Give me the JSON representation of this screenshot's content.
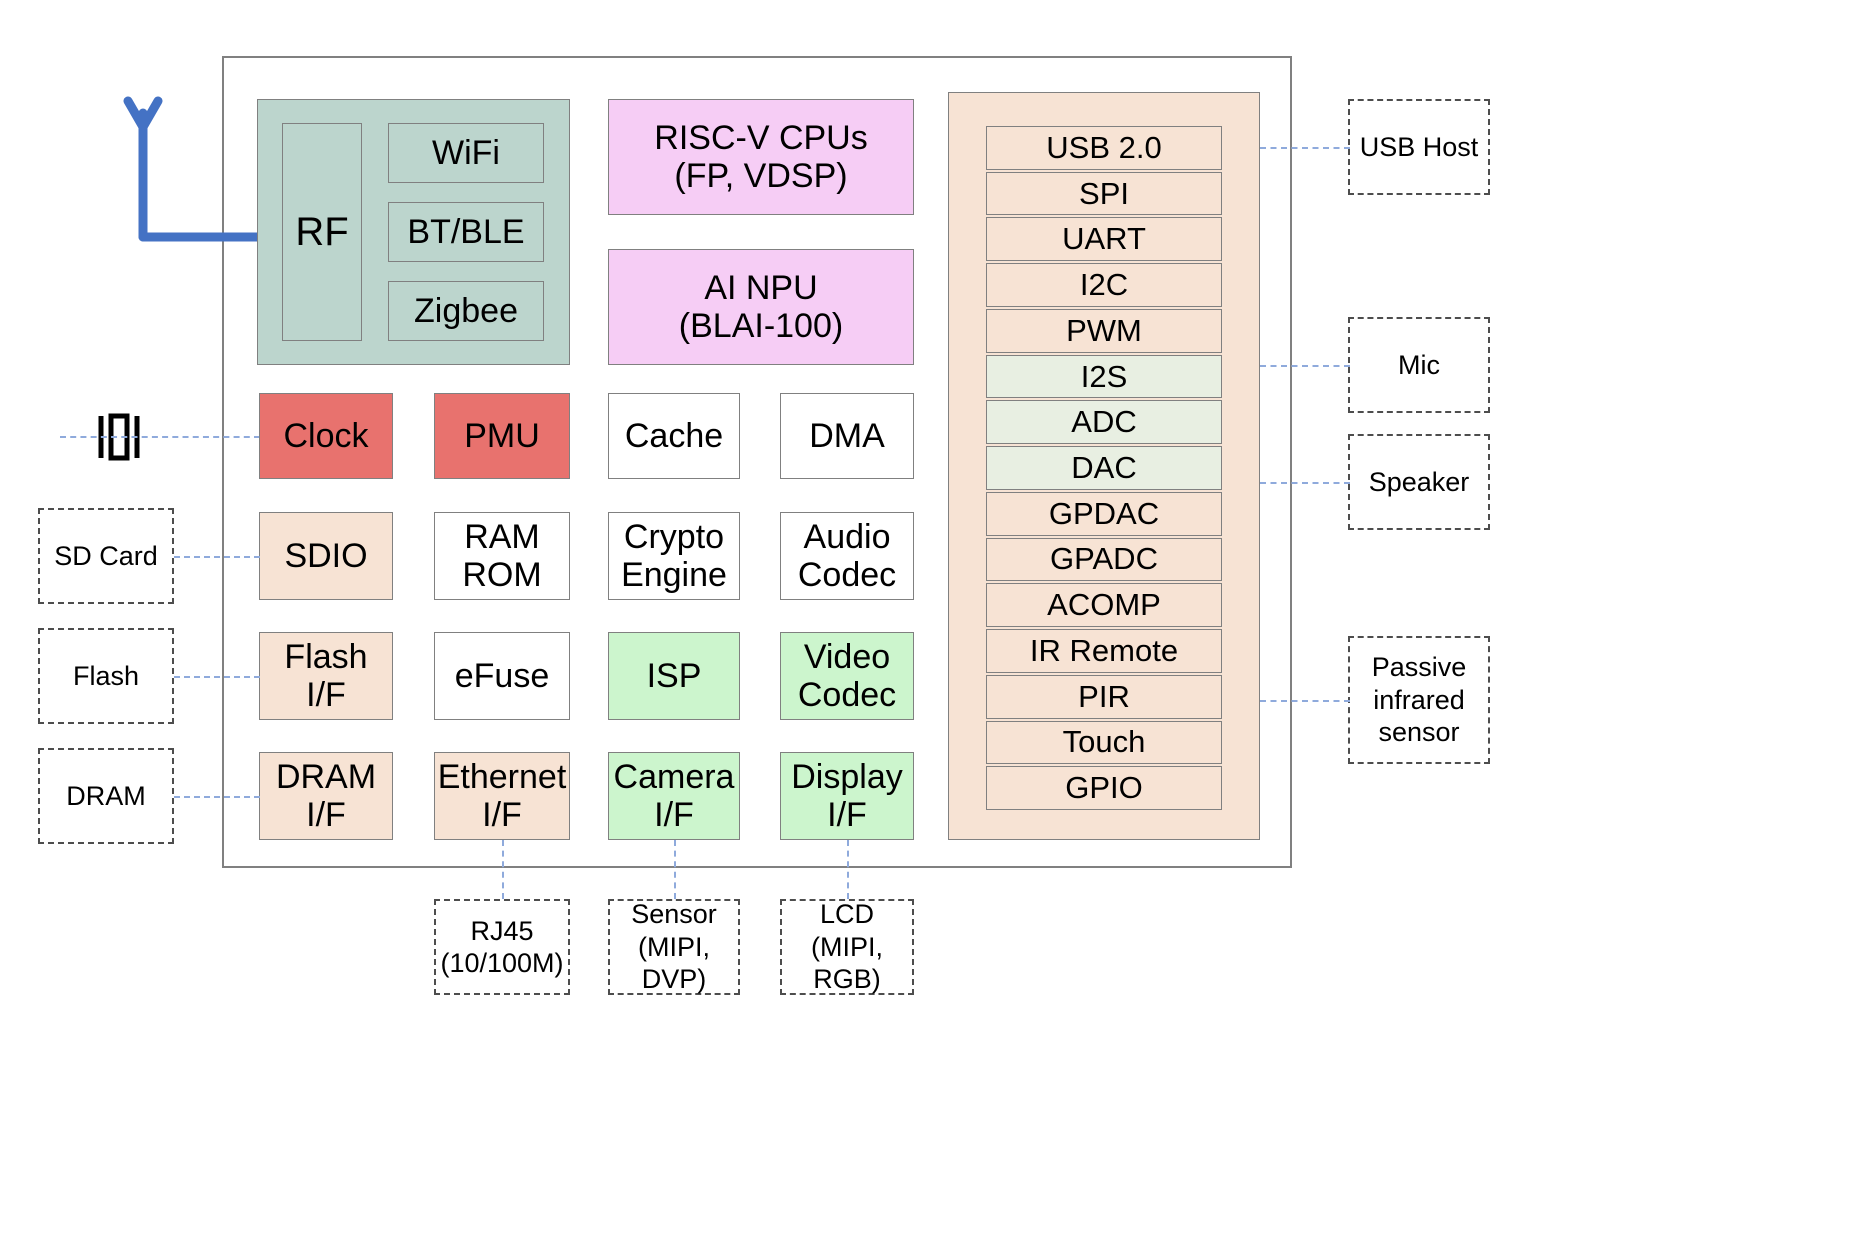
{
  "diagram": {
    "title": "SoC Block Diagram",
    "colors": {
      "teal": "#bcd5cd",
      "pink": "#f6cdf5",
      "red": "#e8726e",
      "peach": "#f7e3d4",
      "green": "#ccf5cd",
      "mint": "#e8efe2",
      "white": "#ffffff",
      "border": "#808080",
      "dashed_border": "#4d4d4d",
      "connector": "#8faadc",
      "antenna": "#4472c4"
    }
  },
  "rf_group": {
    "rf_label": "RF",
    "radios": [
      {
        "label": "WiFi"
      },
      {
        "label": "BT/BLE"
      },
      {
        "label": "Zigbee"
      }
    ]
  },
  "compute": [
    {
      "label": "RISC-V CPUs\n(FP, VDSP)",
      "color": "pink"
    },
    {
      "label": "AI NPU\n(BLAI-100)",
      "color": "pink"
    }
  ],
  "core_grid": {
    "rows": [
      [
        {
          "label": "Clock",
          "color": "red"
        },
        {
          "label": "PMU",
          "color": "red"
        },
        {
          "label": "Cache",
          "color": "white"
        },
        {
          "label": "DMA",
          "color": "white"
        }
      ],
      [
        {
          "label": "SDIO",
          "color": "peach"
        },
        {
          "label": "RAM\nROM",
          "color": "white"
        },
        {
          "label": "Crypto\nEngine",
          "color": "white"
        },
        {
          "label": "Audio\nCodec",
          "color": "white"
        }
      ],
      [
        {
          "label": "Flash\nI/F",
          "color": "peach"
        },
        {
          "label": "eFuse",
          "color": "white"
        },
        {
          "label": "ISP",
          "color": "green"
        },
        {
          "label": "Video\nCodec",
          "color": "green"
        }
      ],
      [
        {
          "label": "DRAM\nI/F",
          "color": "peach"
        },
        {
          "label": "Ethernet\nI/F",
          "color": "peach"
        },
        {
          "label": "Camera\nI/F",
          "color": "green"
        },
        {
          "label": "Display\nI/F",
          "color": "green"
        }
      ]
    ]
  },
  "peripherals": [
    {
      "label": "USB 2.0",
      "color": "peach"
    },
    {
      "label": "SPI",
      "color": "peach"
    },
    {
      "label": "UART",
      "color": "peach"
    },
    {
      "label": "I2C",
      "color": "peach"
    },
    {
      "label": "PWM",
      "color": "peach"
    },
    {
      "label": "I2S",
      "color": "mint"
    },
    {
      "label": "ADC",
      "color": "mint"
    },
    {
      "label": "DAC",
      "color": "mint"
    },
    {
      "label": "GPDAC",
      "color": "peach"
    },
    {
      "label": "GPADC",
      "color": "peach"
    },
    {
      "label": "ACOMP",
      "color": "peach"
    },
    {
      "label": "IR Remote",
      "color": "peach"
    },
    {
      "label": "PIR",
      "color": "peach"
    },
    {
      "label": "Touch",
      "color": "peach"
    },
    {
      "label": "GPIO",
      "color": "peach"
    }
  ],
  "external_left": [
    {
      "label": "SD Card"
    },
    {
      "label": "Flash"
    },
    {
      "label": "DRAM"
    }
  ],
  "external_right": [
    {
      "label": "USB Host"
    },
    {
      "label": "Mic"
    },
    {
      "label": "Speaker"
    },
    {
      "label": "Passive\ninfrared\nsensor"
    }
  ],
  "external_bottom": [
    {
      "label": "RJ45\n(10/100M)"
    },
    {
      "label": "Sensor\n(MIPI, DVP)"
    },
    {
      "label": "LCD\n(MIPI, RGB)"
    }
  ],
  "icons": {
    "antenna": "antenna-icon",
    "crystal": "crystal-oscillator-icon"
  }
}
